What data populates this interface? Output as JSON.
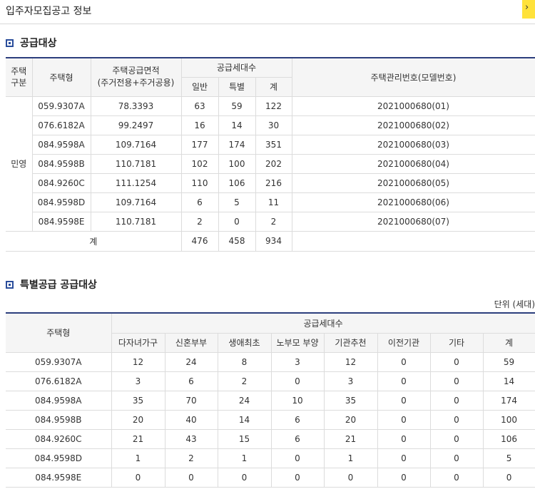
{
  "page_title": "입주자모집공고 정보",
  "corner_icon": "chevron-icon",
  "section1": {
    "title": "공급대상",
    "headers": {
      "kind": "주택\n구분",
      "type": "주택형",
      "area_main": "주택공급면적",
      "area_sub": "(주거전용+주거공용)",
      "units": "공급세대수",
      "general": "일반",
      "special": "특별",
      "total": "계",
      "model": "주택관리번호(모델번호)"
    },
    "kind_value": "민영",
    "rows": [
      {
        "type": "059.9307A",
        "area": "78.3393",
        "general": "63",
        "special": "59",
        "total": "122",
        "model": "2021000680(01)"
      },
      {
        "type": "076.6182A",
        "area": "99.2497",
        "general": "16",
        "special": "14",
        "total": "30",
        "model": "2021000680(02)"
      },
      {
        "type": "084.9598A",
        "area": "109.7164",
        "general": "177",
        "special": "174",
        "total": "351",
        "model": "2021000680(03)"
      },
      {
        "type": "084.9598B",
        "area": "110.7181",
        "general": "102",
        "special": "100",
        "total": "202",
        "model": "2021000680(04)"
      },
      {
        "type": "084.9260C",
        "area": "111.1254",
        "general": "110",
        "special": "106",
        "total": "216",
        "model": "2021000680(05)"
      },
      {
        "type": "084.9598D",
        "area": "109.7164",
        "general": "6",
        "special": "5",
        "total": "11",
        "model": "2021000680(06)"
      },
      {
        "type": "084.9598E",
        "area": "110.7181",
        "general": "2",
        "special": "0",
        "total": "2",
        "model": "2021000680(07)"
      }
    ],
    "sum": {
      "label": "계",
      "general": "476",
      "special": "458",
      "total": "934"
    }
  },
  "section2": {
    "title": "특별공급 공급대상",
    "unit": "단위 (세대)",
    "headers": {
      "type": "주택형",
      "units": "공급세대수",
      "cols": [
        "다자녀가구",
        "신혼부부",
        "생애최초",
        "노부모 부양",
        "기관추천",
        "이전기관",
        "기타",
        "계"
      ]
    },
    "rows": [
      {
        "type": "059.9307A",
        "values": [
          "12",
          "24",
          "8",
          "3",
          "12",
          "0",
          "0",
          "59"
        ]
      },
      {
        "type": "076.6182A",
        "values": [
          "3",
          "6",
          "2",
          "0",
          "3",
          "0",
          "0",
          "14"
        ]
      },
      {
        "type": "084.9598A",
        "values": [
          "35",
          "70",
          "24",
          "10",
          "35",
          "0",
          "0",
          "174"
        ]
      },
      {
        "type": "084.9598B",
        "values": [
          "20",
          "40",
          "14",
          "6",
          "20",
          "0",
          "0",
          "100"
        ]
      },
      {
        "type": "084.9260C",
        "values": [
          "21",
          "43",
          "15",
          "6",
          "21",
          "0",
          "0",
          "106"
        ]
      },
      {
        "type": "084.9598D",
        "values": [
          "1",
          "2",
          "1",
          "0",
          "1",
          "0",
          "0",
          "5"
        ]
      },
      {
        "type": "084.9598E",
        "values": [
          "0",
          "0",
          "0",
          "0",
          "0",
          "0",
          "0",
          "0"
        ]
      }
    ]
  }
}
